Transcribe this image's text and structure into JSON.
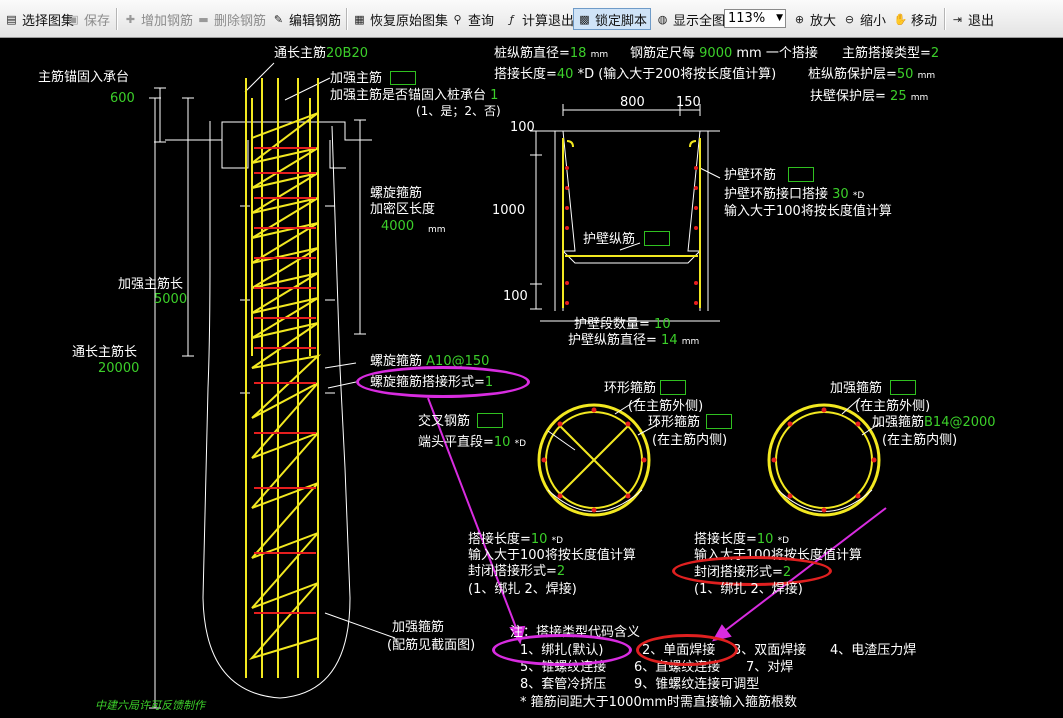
{
  "toolbar": {
    "select_drawing": "选择图集",
    "save": "保存",
    "add_rebar": "增加钢筋",
    "delete_rebar": "删除钢筋",
    "edit_rebar": "编辑钢筋",
    "restore_drawing": "恢复原始图集",
    "query": "查询",
    "calc_exit": "计算退出",
    "lock_script": "锁定脚本",
    "show_full": "显示全图",
    "zoom_value": "113%",
    "zoom_in": "放大",
    "zoom_out": "缩小",
    "move": "移动",
    "exit": "退出"
  },
  "pile": {
    "through_main_rebar_label": "通长主筋",
    "through_main_rebar_spec": "20B20",
    "anchor_label": "主筋锚固入承台",
    "anchor_value": "600",
    "reinforced_main_label": "加强主筋",
    "reinforced_anchor_label": "加强主筋是否锚固入桩承台",
    "reinforced_anchor_value": "1",
    "reinforced_anchor_hint": "(1、是；2、否)",
    "spiral_dense_label1": "螺旋箍筋",
    "spiral_dense_label2": "加密区长度",
    "spiral_dense_value": "4000",
    "spiral_dense_unit": "mm",
    "reinforced_length_label": "加强主筋长",
    "reinforced_length_value": "5000",
    "through_length_label": "通长主筋长",
    "through_length_value": "20000",
    "spiral_stirrup_label": "螺旋箍筋",
    "spiral_stirrup_spec": "A10@150",
    "spiral_lap_label": "螺旋箍筋搭接形式=",
    "spiral_lap_value": "1",
    "stiffener_label": "加强箍筋",
    "stiffener_hint": "(配筋见截面图)"
  },
  "header_params": {
    "pile_long_dia_label": "桩纵筋直径=",
    "pile_long_dia_value": "18",
    "unit_mm": "mm",
    "fixed_length_label": "钢筋定尺每",
    "fixed_length_value": "9000",
    "fixed_length_suffix": "mm 一个搭接",
    "main_lap_type_label": "主筋搭接类型=",
    "main_lap_type_value": "2",
    "lap_length_label": "搭接长度=",
    "lap_length_value": "40",
    "lap_length_hint": "*D (输入大于200将按长度值计算)",
    "long_cover_label": "桩纵筋保护层=",
    "long_cover_value": "50",
    "wall_cover_label": "扶壁保护层=",
    "wall_cover_value": "25"
  },
  "wall_section": {
    "dim_800": "800",
    "dim_150": "150",
    "dim_100_top": "100",
    "dim_1000": "1000",
    "dim_100_bottom": "100",
    "ring_rebar_label": "护壁环筋",
    "ring_lap_label": "护壁环筋接口搭接",
    "ring_lap_value": "30",
    "ring_lap_unit": "*D",
    "ring_lap_hint": "输入大于100将按长度值计算",
    "long_rebar_label": "护壁纵筋",
    "segment_count_label": "护壁段数量=",
    "segment_count_value": "10",
    "long_dia_label": "护壁纵筋直径=",
    "long_dia_value": "14",
    "long_dia_unit": "mm"
  },
  "section_left": {
    "ring_stirrup_outer_label": "环形箍筋",
    "ring_stirrup_outer_hint": "(在主筋外侧)",
    "ring_stirrup_inner_label": "环形箍筋",
    "ring_stirrup_inner_hint": "(在主筋内侧)",
    "cross_rebar_label": "交叉钢筋",
    "end_straight_label": "端头平直段=",
    "end_straight_value": "10",
    "end_straight_unit": "*D",
    "lap_length_label": "搭接长度=",
    "lap_length_value": "10",
    "lap_length_unit": "*D",
    "lap_hint": "输入大于100将按长度值计算",
    "closed_lap_label": "封闭搭接形式=",
    "closed_lap_value": "2",
    "closed_lap_hint": "(1、绑扎  2、焊接)"
  },
  "section_right": {
    "stiffener_outer_label": "加强箍筋",
    "stiffener_outer_hint": "(在主筋外侧)",
    "stiffener_inner_label": "加强箍筋",
    "stiffener_inner_spec": "B14@2000",
    "stiffener_inner_hint": "(在主筋内侧)",
    "lap_length_label": "搭接长度=",
    "lap_length_value": "10",
    "lap_length_unit": "*D",
    "lap_hint": "输入大于100将按长度值计算",
    "closed_lap_label": "封闭搭接形式=",
    "closed_lap_value": "2",
    "closed_lap_hint": "(1、绑扎  2、焊接)"
  },
  "legend": {
    "title": "注：搭接类型代码含义",
    "row1": [
      "1、绑扎(默认)",
      "2、单面焊接",
      "3、双面焊接",
      "4、电渣压力焊"
    ],
    "row2": [
      "5、锥螺纹连接",
      "6、直螺纹连接",
      "7、对焊"
    ],
    "row3": [
      "8、套管冷挤压",
      "9、锥螺纹连接可调型"
    ],
    "note": "* 箍筋间距大于1000mm时需直接输入箍筋根数"
  },
  "footer_credit": "中建六局许可反馈制作",
  "colors": {
    "rebar_yellow": "#f2e820",
    "stirrup_red": "#e51e1e",
    "value_green": "#3ccf2a",
    "annotation_magenta": "#d82ce0"
  }
}
